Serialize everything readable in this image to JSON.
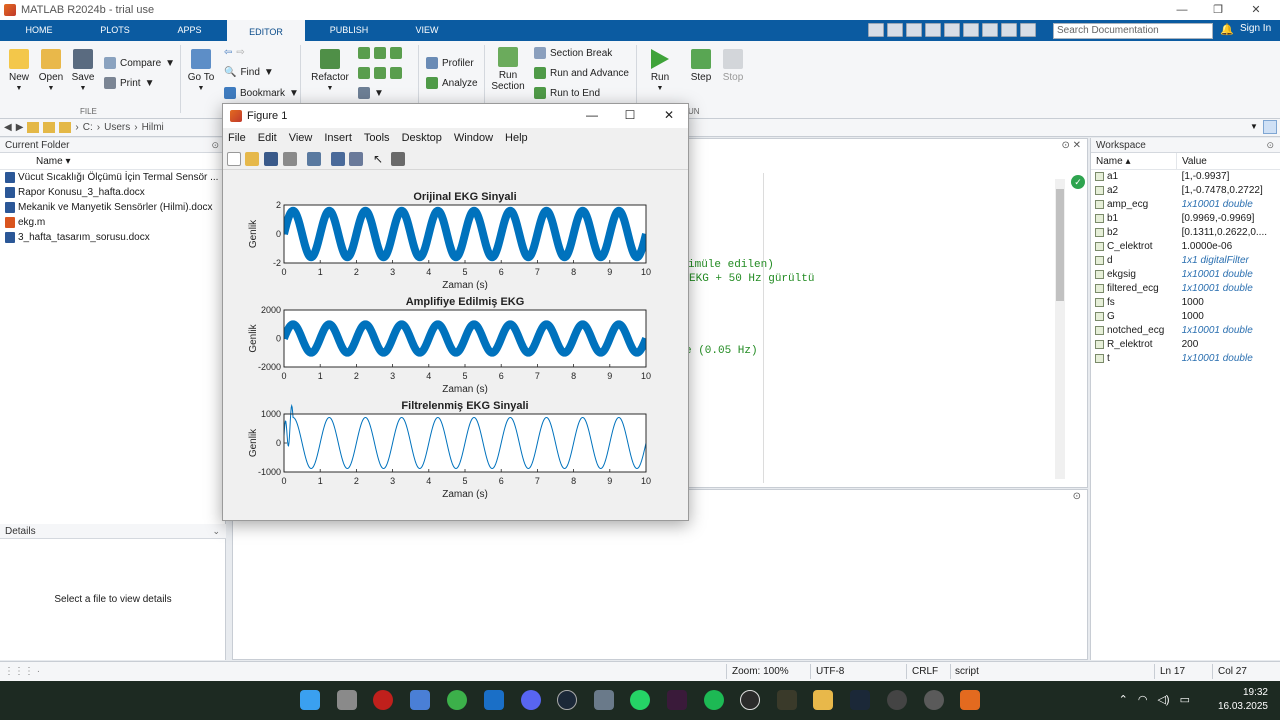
{
  "window": {
    "title": "MATLAB R2024b - trial use",
    "controls": [
      "—",
      "❐",
      "✕"
    ]
  },
  "tabs": [
    {
      "label": "HOME"
    },
    {
      "label": "PLOTS"
    },
    {
      "label": "APPS"
    },
    {
      "label": "EDITOR"
    },
    {
      "label": "PUBLISH"
    },
    {
      "label": "VIEW"
    }
  ],
  "search_doc": {
    "placeholder": "Search Documentation"
  },
  "sign_in": "Sign In",
  "ribbon": {
    "new": "New",
    "open": "Open",
    "save": "Save",
    "compare": "Compare",
    "print": "Print",
    "file_group": "FILE",
    "go_to": "Go To",
    "find": "Find",
    "bookmark": "Bookmark",
    "refactor": "Refactor",
    "profiler": "Profiler",
    "analyze": "Analyze",
    "run_section": "Run\nSection",
    "run_section_l1": "Run",
    "run_section_l2": "Section",
    "section_break": "Section Break",
    "run_and_advance": "Run and Advance",
    "run_to_end": "Run to End",
    "run": "Run",
    "step": "Step",
    "stop": "Stop",
    "run_group_partial": "UN"
  },
  "address": {
    "path": [
      "C:",
      "Users",
      "Hilmi"
    ]
  },
  "current_folder": {
    "title": "Current Folder",
    "name_col": "Name",
    "files": [
      {
        "name": "Vücut Sıcaklığı Ölçümü İçin Termal Sensör ...",
        "color": "#2b5797"
      },
      {
        "name": "Rapor Konusu_3_hafta.docx",
        "color": "#2b5797"
      },
      {
        "name": "Mekanik ve Manyetik Sensörler (Hilmi).docx",
        "color": "#2b5797"
      },
      {
        "name": "ekg.m",
        "color": "#d9541e"
      },
      {
        "name": "3_hafta_tasarım_sorusu.docx",
        "color": "#2b5797"
      }
    ]
  },
  "details": {
    "title": "Details",
    "message": "Select a file to view details"
  },
  "editor": {
    "code_fragments": [
      "imüle edilen)",
      "EKG + 50 Hz gürültü",
      "e (0.05 Hz)"
    ]
  },
  "workspace": {
    "title": "Workspace",
    "name_col": "Name",
    "value_col": "Value",
    "vars": [
      {
        "name": "a1",
        "value": "[1,-0.9937]",
        "italic": false
      },
      {
        "name": "a2",
        "value": "[1,-0.7478,0.2722]",
        "italic": false
      },
      {
        "name": "amp_ecg",
        "value": "1x10001 double",
        "italic": true
      },
      {
        "name": "b1",
        "value": "[0.9969,-0.9969]",
        "italic": false
      },
      {
        "name": "b2",
        "value": "[0.1311,0.2622,0....",
        "italic": false
      },
      {
        "name": "C_elektrot",
        "value": "1.0000e-06",
        "italic": false
      },
      {
        "name": "d",
        "value": "1x1 digitalFilter",
        "italic": true
      },
      {
        "name": "ekgsig",
        "value": "1x10001 double",
        "italic": true
      },
      {
        "name": "filtered_ecg",
        "value": "1x10001 double",
        "italic": true
      },
      {
        "name": "fs",
        "value": "1000",
        "italic": false
      },
      {
        "name": "G",
        "value": "1000",
        "italic": false
      },
      {
        "name": "notched_ecg",
        "value": "1x10001 double",
        "italic": true
      },
      {
        "name": "R_elektrot",
        "value": "200",
        "italic": false
      },
      {
        "name": "t",
        "value": "1x10001 double",
        "italic": true
      }
    ]
  },
  "status": {
    "zoom": "Zoom: 100%",
    "encoding": "UTF-8",
    "eol": "CRLF",
    "type": "script",
    "ln": "Ln  17",
    "col": "Col  27"
  },
  "clock": {
    "time": "19:32",
    "date": "16.03.2025"
  },
  "figure": {
    "title": "Figure 1",
    "menu": [
      "File",
      "Edit",
      "View",
      "Insert",
      "Tools",
      "Desktop",
      "Window",
      "Help"
    ]
  },
  "chart_data": [
    {
      "type": "line",
      "title": "Orijinal EKG Sinyali",
      "xlabel": "Zaman (s)",
      "ylabel": "Genlik",
      "xlim": [
        0,
        10
      ],
      "ylim": [
        -2,
        2
      ],
      "xticks": [
        "0",
        "1",
        "2",
        "3",
        "4",
        "5",
        "6",
        "7",
        "8",
        "9",
        "10"
      ],
      "yticks": [
        "2",
        "0",
        "-2"
      ],
      "series": [
        {
          "amplitude": 1.6,
          "frequency_hz": 1,
          "band": 0.55,
          "color": "#0072bd"
        }
      ]
    },
    {
      "type": "line",
      "title": "Amplifiye Edilmiş EKG",
      "xlabel": "Zaman (s)",
      "ylabel": "Genlik",
      "xlim": [
        0,
        10
      ],
      "ylim": [
        -2000,
        2000
      ],
      "xticks": [
        "0",
        "1",
        "2",
        "3",
        "4",
        "5",
        "6",
        "7",
        "8",
        "9",
        "10"
      ],
      "yticks": [
        "2000",
        "0",
        "-2000"
      ],
      "series": [
        {
          "amplitude": 1000,
          "frequency_hz": 1,
          "band": 550,
          "color": "#0072bd"
        }
      ]
    },
    {
      "type": "line",
      "title": "Filtrelenmiş EKG Sinyali",
      "xlabel": "Zaman (s)",
      "ylabel": "Genlik",
      "xlim": [
        0,
        10
      ],
      "ylim": [
        -1000,
        1000
      ],
      "xticks": [
        "0",
        "1",
        "2",
        "3",
        "4",
        "5",
        "6",
        "7",
        "8",
        "9",
        "10"
      ],
      "yticks": [
        "1000",
        "0",
        "-1000"
      ],
      "series": [
        {
          "amplitude": 880,
          "frequency_hz": 1,
          "band": 0,
          "color": "#0072bd"
        }
      ]
    }
  ]
}
